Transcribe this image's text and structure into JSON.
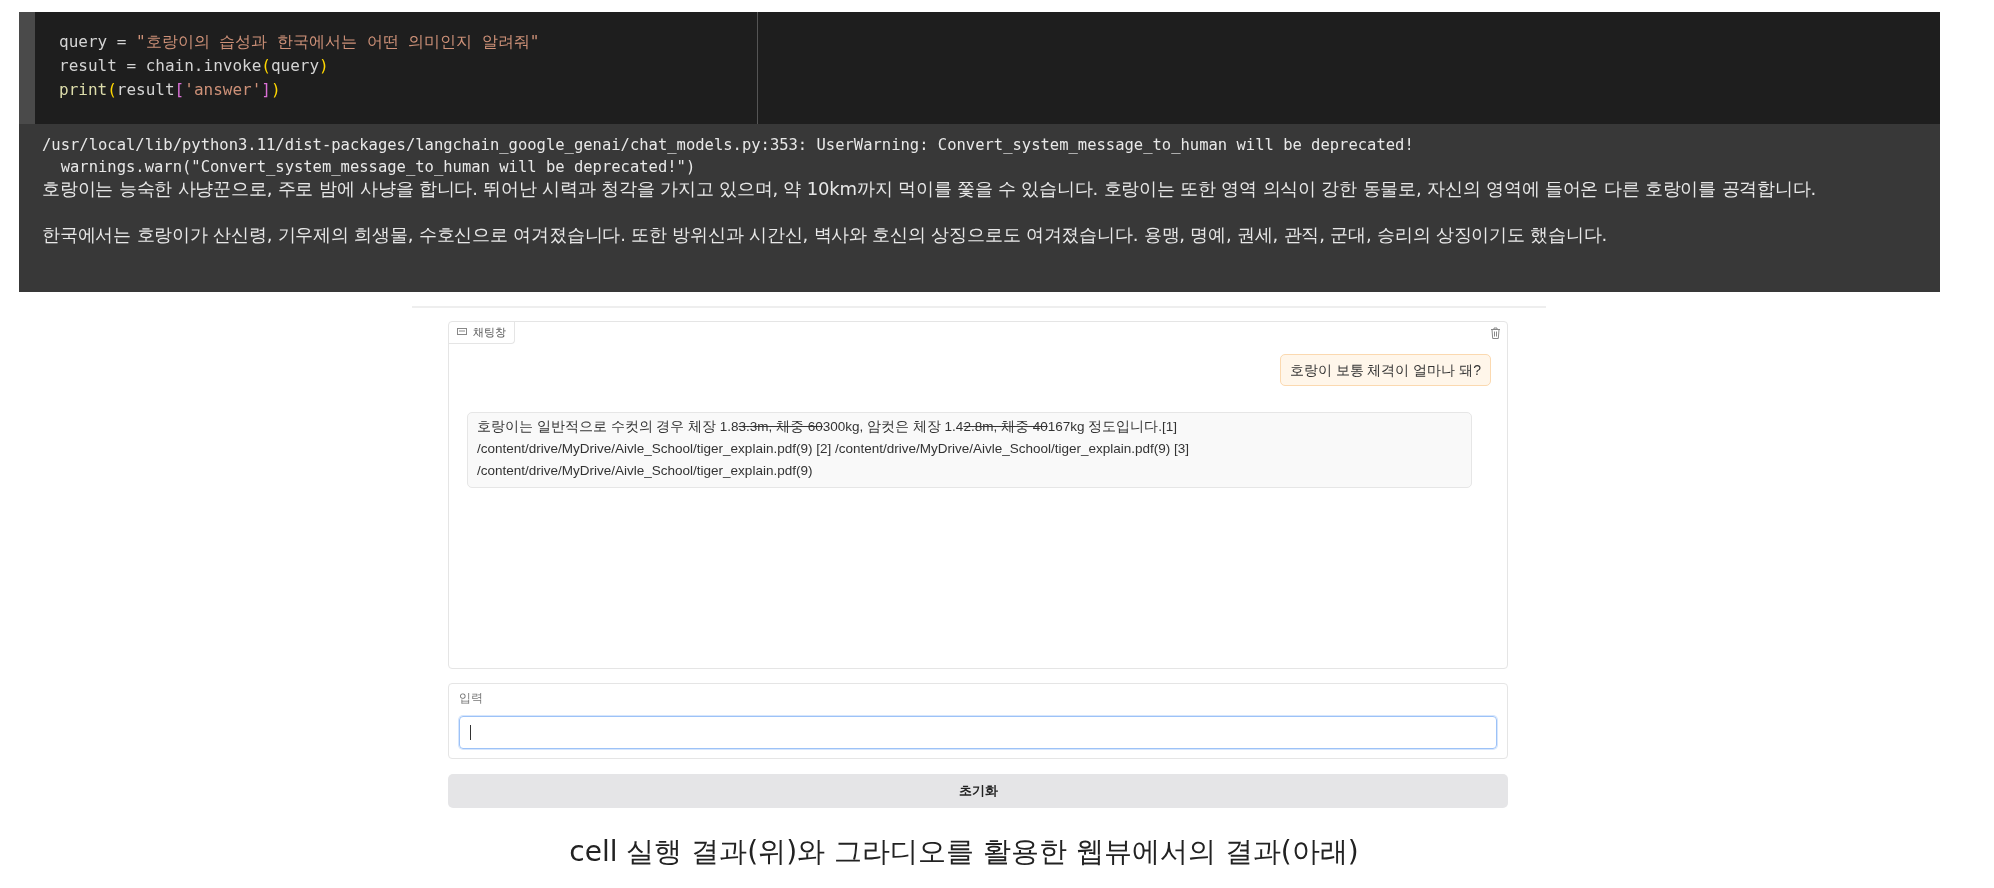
{
  "code_cell": {
    "lines": [
      [
        {
          "kind": "plain",
          "text": "query = "
        },
        {
          "kind": "string",
          "text": "\"호랑이의 습성과 한국에서는 어떤 의미인지 알려줘\""
        }
      ],
      [
        {
          "kind": "plain",
          "text": "result = chain.invoke"
        },
        {
          "kind": "paren",
          "text": "("
        },
        {
          "kind": "plain",
          "text": "query"
        },
        {
          "kind": "paren",
          "text": ")"
        }
      ],
      [
        {
          "kind": "builtin",
          "text": "print"
        },
        {
          "kind": "paren",
          "text": "("
        },
        {
          "kind": "plain",
          "text": "result"
        },
        {
          "kind": "bracket",
          "text": "["
        },
        {
          "kind": "string",
          "text": "'answer'"
        },
        {
          "kind": "bracket",
          "text": "]"
        },
        {
          "kind": "paren",
          "text": ")"
        }
      ]
    ]
  },
  "output": {
    "warning_lines": [
      "/usr/local/lib/python3.11/dist-packages/langchain_google_genai/chat_models.py:353: UserWarning: Convert_system_message_to_human will be deprecated!",
      "  warnings.warn(\"Convert_system_message_to_human will be deprecated!\")"
    ],
    "answer_paragraphs": [
      "호랑이는 능숙한 사냥꾼으로, 주로 밤에 사냥을 합니다. 뛰어난 시력과 청각을 가지고 있으며, 약 10km까지 먹이를 쫓을 수 있습니다. 호랑이는 또한 영역 의식이 강한 동물로, 자신의 영역에 들어온 다른 호랑이를 공격합니다.",
      "한국에서는 호랑이가 산신령, 기우제의 희생물, 수호신으로 여겨졌습니다. 또한 방위신과 시간신, 벽사와 호신의 상징으로도 여겨졌습니다. 용맹, 명예, 권세, 관직, 군대, 승리의 상징이기도 했습니다."
    ]
  },
  "chatbot": {
    "label": "채팅창",
    "messages": [
      {
        "kind": "user",
        "segments": [
          {
            "text": "호랑이 보통 체격이 얼마나 돼?",
            "struck": false
          }
        ]
      },
      {
        "kind": "bot",
        "segments": [
          {
            "text": "호랑이는 일반적으로 수컷의 경우 체장 1.8",
            "struck": false
          },
          {
            "text": "3.3m, 체중 60",
            "struck": true
          },
          {
            "text": "300kg, 암컷은 체장 1.4",
            "struck": false
          },
          {
            "text": "2.8m, 체중 40",
            "struck": true
          },
          {
            "text": "167kg 정도입니다.[1] /content/drive/MyDrive/Aivle_School/tiger_explain.pdf(9) [2] /content/drive/MyDrive/Aivle_School/tiger_explain.pdf(9) [3] /content/drive/MyDrive/Aivle_School/tiger_explain.pdf(9)",
            "struck": false
          }
        ]
      }
    ]
  },
  "input": {
    "label": "입력",
    "focused": true
  },
  "clear_button": {
    "label": "초기화"
  },
  "caption": "cell 실행 결과(위)와 그라디오를 활용한 웹뷰에서의 결과(아래)"
}
